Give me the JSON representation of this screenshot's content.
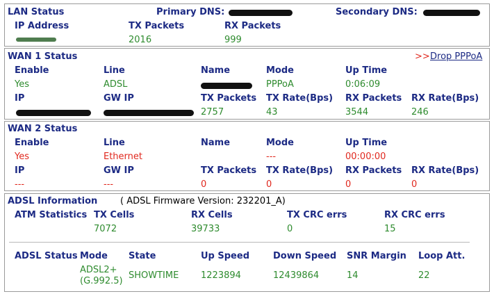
{
  "lan": {
    "title": "LAN Status",
    "primary_dns_label": "Primary DNS:",
    "secondary_dns_label": "Secondary DNS:",
    "ip_label": "IP Address",
    "tx_label": "TX Packets",
    "rx_label": "RX Packets",
    "tx_value": "2016",
    "rx_value": "999"
  },
  "wan1": {
    "title": "WAN 1 Status",
    "drop_prefix": ">>",
    "drop_link": "Drop PPPoA",
    "enable_label": "Enable",
    "line_label": "Line",
    "name_label": "Name",
    "mode_label": "Mode",
    "uptime_label": "Up Time",
    "enable_value": "Yes",
    "line_value": "ADSL",
    "mode_value": "PPPoA",
    "uptime_value": "0:06:09",
    "ip_label": "IP",
    "gw_label": "GW IP",
    "tx_packets_label": "TX Packets",
    "tx_rate_label": "TX Rate(Bps)",
    "rx_packets_label": "RX Packets",
    "rx_rate_label": "RX Rate(Bps)",
    "tx_packets_value": "2757",
    "tx_rate_value": "43",
    "rx_packets_value": "3544",
    "rx_rate_value": "246"
  },
  "wan2": {
    "title": "WAN 2 Status",
    "enable_label": "Enable",
    "line_label": "Line",
    "name_label": "Name",
    "mode_label": "Mode",
    "uptime_label": "Up Time",
    "enable_value": "Yes",
    "line_value": "Ethernet",
    "mode_value": "---",
    "uptime_value": "00:00:00",
    "ip_label": "IP",
    "gw_label": "GW IP",
    "tx_packets_label": "TX Packets",
    "tx_rate_label": "TX Rate(Bps)",
    "rx_packets_label": "RX Packets",
    "rx_rate_label": "RX Rate(Bps)",
    "ip_value": "---",
    "gw_value": "---",
    "tx_packets_value": "0",
    "tx_rate_value": "0",
    "rx_packets_value": "0",
    "rx_rate_value": "0"
  },
  "adsl": {
    "title": "ADSL Information",
    "firmware_text": "( ADSL Firmware Version:  232201_A)",
    "atm_label": "ATM Statistics",
    "tx_cells_label": "TX Cells",
    "rx_cells_label": "RX Cells",
    "tx_crc_label": "TX CRC errs",
    "rx_crc_label": "RX CRC errs",
    "tx_cells_value": "7072",
    "rx_cells_value": "39733",
    "tx_crc_value": "0",
    "rx_crc_value": "15",
    "status_label": "ADSL Status",
    "mode_label": "Mode",
    "state_label": "State",
    "up_speed_label": "Up Speed",
    "down_speed_label": "Down Speed",
    "snr_label": "SNR Margin",
    "loop_label": "Loop Att.",
    "mode_value_line1": "ADSL2+",
    "mode_value_line2": "(G.992.5)",
    "state_value": "SHOWTIME",
    "up_speed_value": "1223894",
    "down_speed_value": "12439864",
    "snr_value": "14",
    "loop_value": "22"
  },
  "colors": {
    "heading": "#1c2a84",
    "value_ok": "#2e8b2e",
    "value_down": "#e0281e",
    "border": "#9a9a9a"
  }
}
